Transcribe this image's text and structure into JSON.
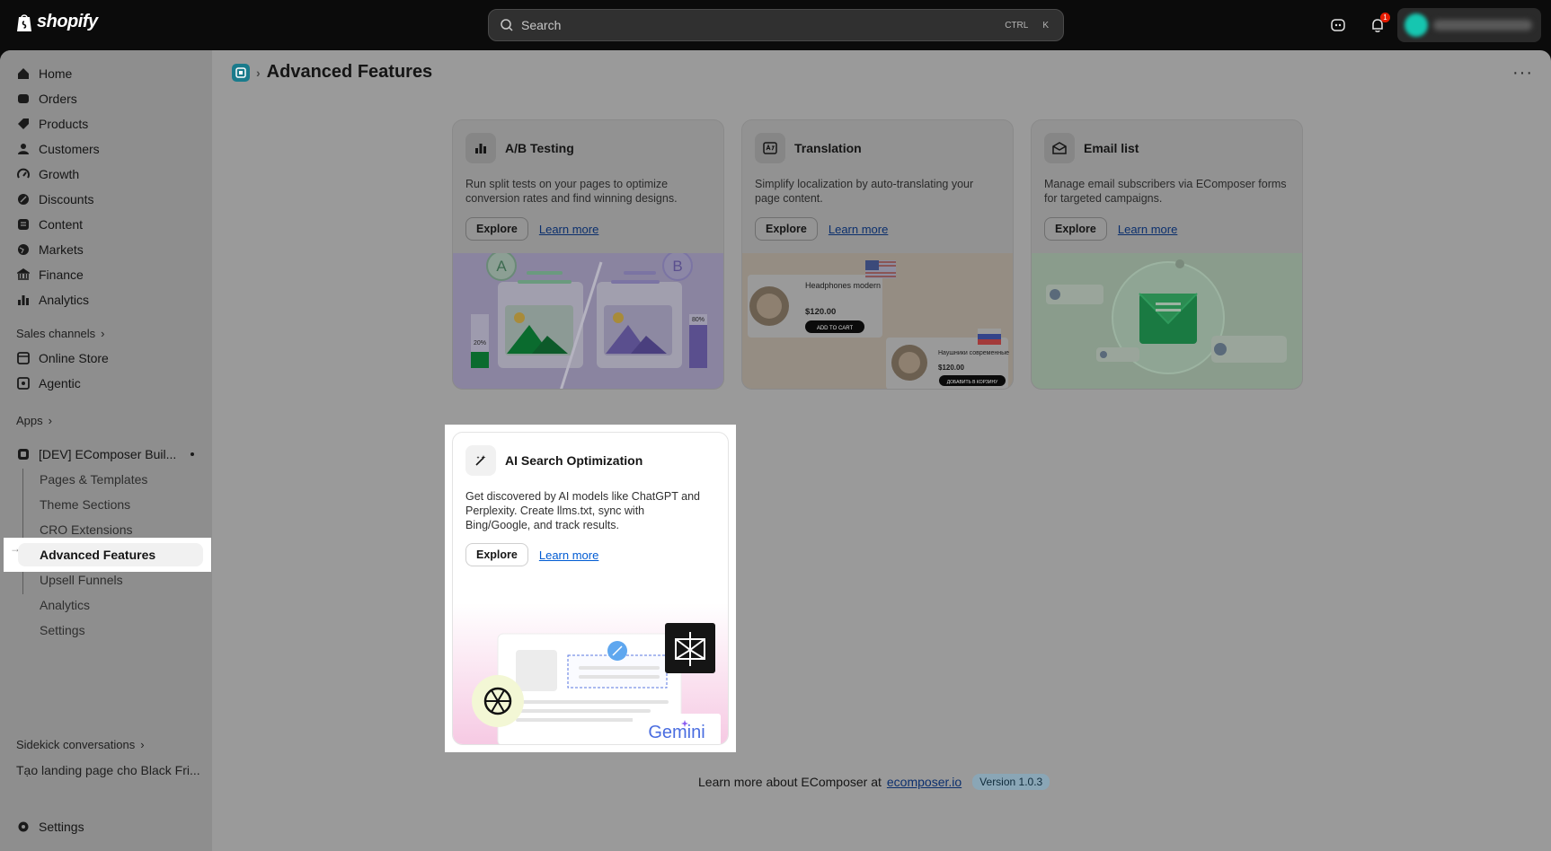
{
  "topbar": {
    "logo": "shopify",
    "search_placeholder": "Search",
    "shortcut_ctrl": "CTRL",
    "shortcut_k": "K",
    "notification_count": "1"
  },
  "sidebar": {
    "nav": [
      "Home",
      "Orders",
      "Products",
      "Customers",
      "Growth",
      "Discounts",
      "Content",
      "Markets",
      "Finance",
      "Analytics"
    ],
    "sales_channels_label": "Sales channels",
    "sales_channels": [
      "Online Store",
      "Agentic"
    ],
    "apps_label": "Apps",
    "app_name": "[DEV] EComposer Buil...",
    "app_items": [
      "Pages & Templates",
      "Theme Sections",
      "CRO Extensions",
      "Advanced Features",
      "Upsell Funnels",
      "Analytics",
      "Settings"
    ],
    "sidekick_label": "Sidekick conversations",
    "sidekick_item": "Tạo landing page cho Black Fri...",
    "settings": "Settings"
  },
  "page": {
    "title": "Advanced Features"
  },
  "cards": [
    {
      "title": "A/B Testing",
      "desc": "Run split tests on your pages to optimize conversion rates and find winning designs.",
      "explore": "Explore",
      "learn": "Learn more",
      "illus": {
        "a": "A",
        "b": "B",
        "p1": "20%",
        "p2": "80%"
      }
    },
    {
      "title": "Translation",
      "desc": "Simplify localization by auto-translating your page content.",
      "explore": "Explore",
      "learn": "Learn more",
      "illus": {
        "name1": "Headphones modern",
        "price1": "$120.00",
        "cta1": "ADD TO CART",
        "name2": "Наушники современные",
        "price2": "$120.00",
        "cta2": "ДОБАВИТЬ В КОРЗИНУ"
      }
    },
    {
      "title": "Email list",
      "desc": "Manage email subscribers via EComposer forms for targeted campaigns.",
      "explore": "Explore",
      "learn": "Learn more"
    },
    {
      "title": "AI Search Optimization",
      "desc": "Get discovered by AI models like ChatGPT and Perplexity. Create llms.txt, sync with Bing/Google, and track results.",
      "explore": "Explore",
      "learn": "Learn more",
      "illus": {
        "gemini": "Gemini"
      }
    }
  ],
  "footer": {
    "text": "Learn more about EComposer at",
    "link": "ecomposer.io",
    "version": "Version 1.0.3"
  }
}
